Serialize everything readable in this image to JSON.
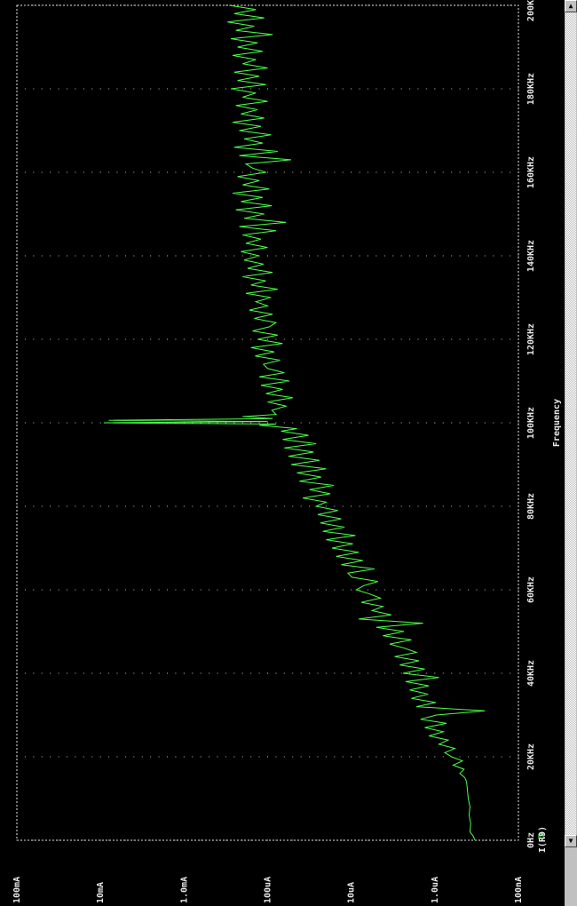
{
  "chart_data": {
    "type": "line",
    "orientation": "rotated-90-clockwise",
    "xlabel": "Frequency",
    "x_ticks": [
      "0Hz",
      "20KHz",
      "40KHz",
      "60KHz",
      "80KHz",
      "100KHz",
      "120KHz",
      "140KHz",
      "160KHz",
      "180KHz",
      "200KHz"
    ],
    "y_ticks": [
      "100nA",
      "1.0uA",
      "10uA",
      "100uA",
      "1.0mA",
      "10mA",
      "100mA"
    ],
    "xlim": [
      0,
      200000
    ],
    "ylim_log10_amps": [
      -7,
      -1
    ],
    "legend": {
      "marker": "square",
      "label": "I(R9)"
    },
    "series": [
      {
        "name": "I(R9)",
        "color": "#4cff4c",
        "x": [
          0,
          1000,
          2000,
          4000,
          6000,
          8000,
          10000,
          12000,
          14000,
          15000,
          16000,
          17000,
          18000,
          19000,
          20000,
          21000,
          22000,
          23000,
          24000,
          25000,
          26000,
          27000,
          28000,
          29000,
          30000,
          31000,
          32000,
          33000,
          34000,
          35000,
          36000,
          37000,
          38000,
          39000,
          40000,
          41000,
          42000,
          43000,
          44000,
          45000,
          46000,
          47000,
          48000,
          49000,
          50000,
          51000,
          52000,
          53000,
          54000,
          55000,
          56000,
          57000,
          58000,
          59000,
          60000,
          61000,
          62000,
          63000,
          64000,
          65000,
          66000,
          67000,
          68000,
          69000,
          70000,
          71000,
          72000,
          73000,
          74000,
          75000,
          76000,
          77000,
          78000,
          79000,
          80000,
          81000,
          82000,
          83000,
          84000,
          85000,
          86000,
          87000,
          88000,
          89000,
          90000,
          91000,
          92000,
          93000,
          94000,
          95000,
          96000,
          97000,
          98000,
          98600,
          99000,
          99400,
          99700,
          100000,
          100300,
          100600,
          101000,
          101500,
          102000,
          103000,
          104000,
          105000,
          106000,
          107000,
          108000,
          109000,
          110000,
          111000,
          112000,
          113000,
          114000,
          115000,
          116000,
          117000,
          118000,
          119000,
          120000,
          121000,
          122000,
          123000,
          124000,
          125000,
          126000,
          127000,
          128000,
          129000,
          130000,
          131000,
          132000,
          133000,
          134000,
          135000,
          136000,
          137000,
          138000,
          139000,
          140000,
          141000,
          142000,
          143000,
          144000,
          145000,
          146000,
          147000,
          148000,
          149000,
          150000,
          151000,
          152000,
          153000,
          154000,
          155000,
          156000,
          157000,
          158000,
          159000,
          160000,
          161000,
          162000,
          163000,
          164000,
          165000,
          166000,
          167000,
          168000,
          169000,
          170000,
          171000,
          172000,
          173000,
          174000,
          175000,
          176000,
          177000,
          178000,
          179000,
          180000,
          181000,
          182000,
          183000,
          184000,
          185000,
          186000,
          187000,
          188000,
          189000,
          190000,
          191000,
          192000,
          193000,
          194000,
          195000,
          196000,
          197000,
          198000,
          199000,
          200000
        ],
        "y_log10": [
          -6.48,
          -6.46,
          -6.42,
          -6.43,
          -6.41,
          -6.42,
          -6.4,
          -6.39,
          -6.38,
          -6.36,
          -6.3,
          -6.35,
          -6.22,
          -6.33,
          -6.2,
          -6.12,
          -6.24,
          -6.05,
          -6.16,
          -5.93,
          -6.1,
          -5.88,
          -6.14,
          -5.83,
          -6.02,
          -6.6,
          -5.78,
          -6.01,
          -5.72,
          -5.92,
          -5.7,
          -5.93,
          -5.65,
          -6.05,
          -5.62,
          -5.88,
          -5.58,
          -5.81,
          -5.52,
          -5.78,
          -5.64,
          -5.46,
          -5.72,
          -5.38,
          -5.63,
          -5.3,
          -5.86,
          -5.09,
          -5.48,
          -5.25,
          -5.38,
          -5.12,
          -5.35,
          -5.22,
          -5.06,
          -5.15,
          -5.32,
          -5.01,
          -4.96,
          -5.28,
          -4.88,
          -5.14,
          -4.82,
          -5.09,
          -4.77,
          -5.02,
          -4.7,
          -5.05,
          -4.66,
          -4.92,
          -4.63,
          -4.88,
          -4.6,
          -4.84,
          -4.58,
          -4.7,
          -4.42,
          -4.75,
          -4.5,
          -4.79,
          -4.38,
          -4.64,
          -4.35,
          -4.7,
          -4.28,
          -4.62,
          -4.25,
          -4.55,
          -4.2,
          -4.58,
          -4.18,
          -4.49,
          -4.16,
          -4.35,
          -4.14,
          -3.9,
          -4.1,
          -2.04,
          -4.0,
          -2.1,
          -4.06,
          -3.7,
          -4.1,
          -4.05,
          -4.22,
          -4.0,
          -4.3,
          -3.98,
          -4.18,
          -3.92,
          -4.26,
          -3.9,
          -4.2,
          -4.0,
          -3.95,
          -4.15,
          -3.85,
          -4.08,
          -3.8,
          -4.18,
          -3.88,
          -4.12,
          -3.82,
          -4.02,
          -4.1,
          -3.84,
          -4.06,
          -3.78,
          -4.0,
          -3.86,
          -4.04,
          -3.74,
          -4.12,
          -3.8,
          -3.98,
          -3.7,
          -4.06,
          -3.76,
          -3.95,
          -3.72,
          -3.9,
          -3.68,
          -4.0,
          -3.74,
          -3.92,
          -3.7,
          -4.1,
          -3.66,
          -4.22,
          -3.72,
          -3.96,
          -3.62,
          -4.05,
          -3.68,
          -3.94,
          -3.58,
          -4.02,
          -3.7,
          -3.9,
          -3.64,
          -3.98,
          -3.82,
          -3.74,
          -4.28,
          -3.66,
          -4.12,
          -3.6,
          -3.94,
          -3.72,
          -4.04,
          -3.66,
          -3.92,
          -3.58,
          -3.96,
          -3.68,
          -3.88,
          -3.62,
          -4.0,
          -3.7,
          -3.86,
          -3.56,
          -3.98,
          -3.64,
          -3.9,
          -3.6,
          -4.0,
          -3.7,
          -3.86,
          -3.58,
          -3.94,
          -3.64,
          -3.88,
          -3.56,
          -4.06,
          -3.62,
          -3.84,
          -3.52,
          -3.96,
          -3.6,
          -3.86,
          -3.54,
          -3.9,
          -3.58,
          -3.8,
          -3.5,
          -4.05,
          -3.56,
          -3.78,
          -3.52,
          -3.92,
          -3.54,
          -3.96,
          -3.5,
          -3.88,
          -3.6,
          -3.82,
          -3.48,
          -3.9,
          -3.55
        ]
      }
    ],
    "grid": true
  }
}
